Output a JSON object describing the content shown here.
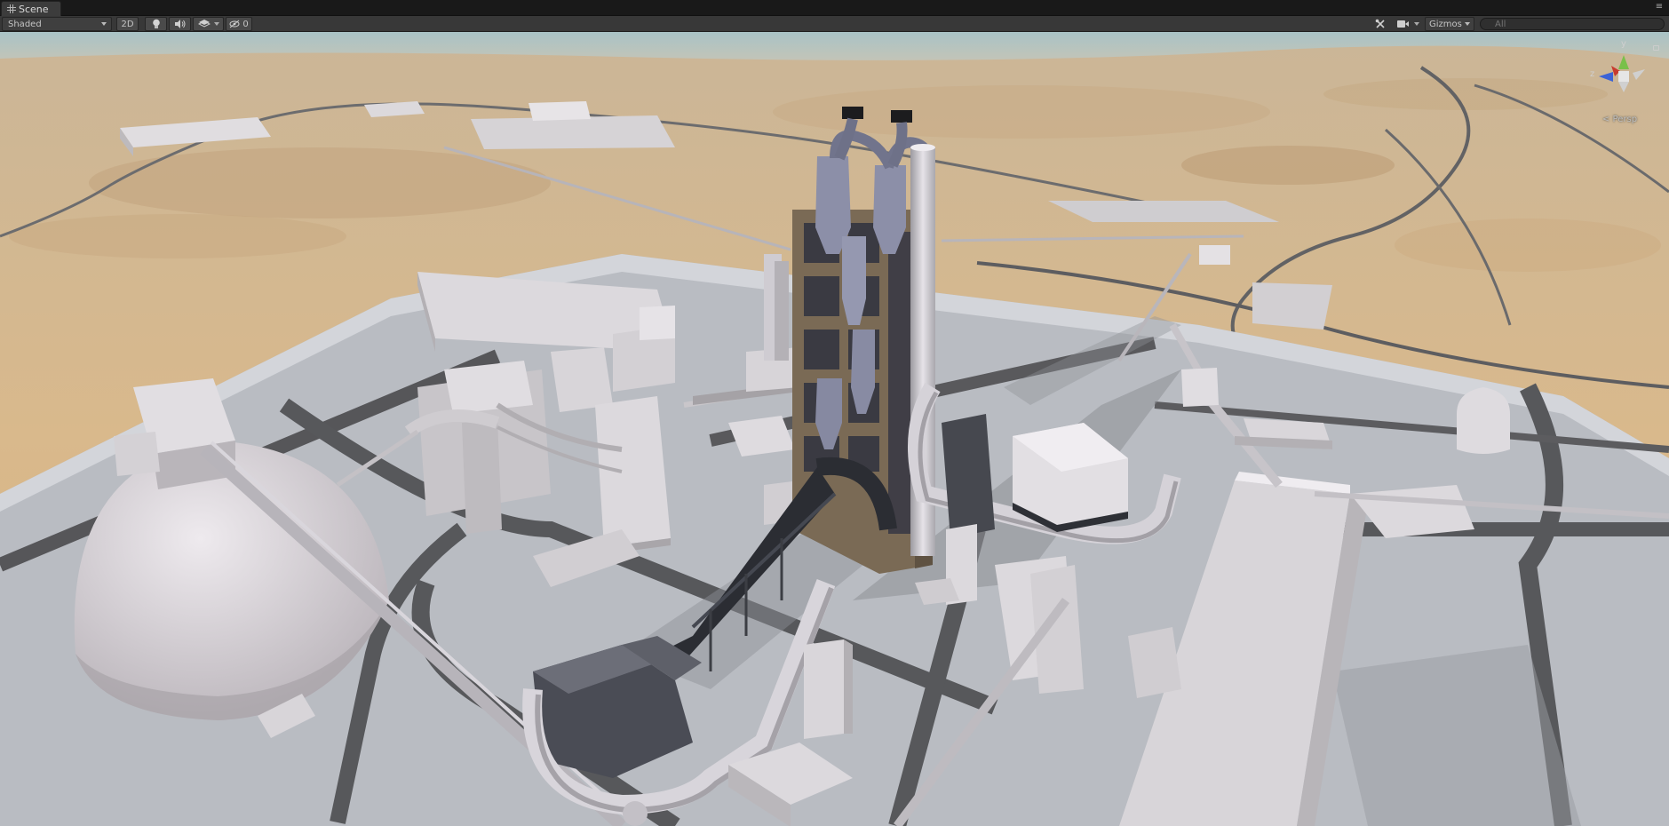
{
  "tab": {
    "label": "Scene"
  },
  "toolbar": {
    "shading_mode": "Shaded",
    "mode_2d": "2D",
    "hidden_count": "0",
    "gizmos_label": "Gizmos",
    "search_placeholder": "All"
  },
  "view": {
    "projection_label": "< Persp"
  },
  "gizmo": {
    "axis_y": "y",
    "axis_z": "z"
  },
  "colors": {
    "sand": "#d8b88e",
    "concrete": "#b9bcc2",
    "road": "#555659",
    "building": "#d5d2d6",
    "tower_frame": "#7d6a52",
    "cyclone": "#8c8fa8",
    "sky_haze": "#a7c1c4"
  }
}
